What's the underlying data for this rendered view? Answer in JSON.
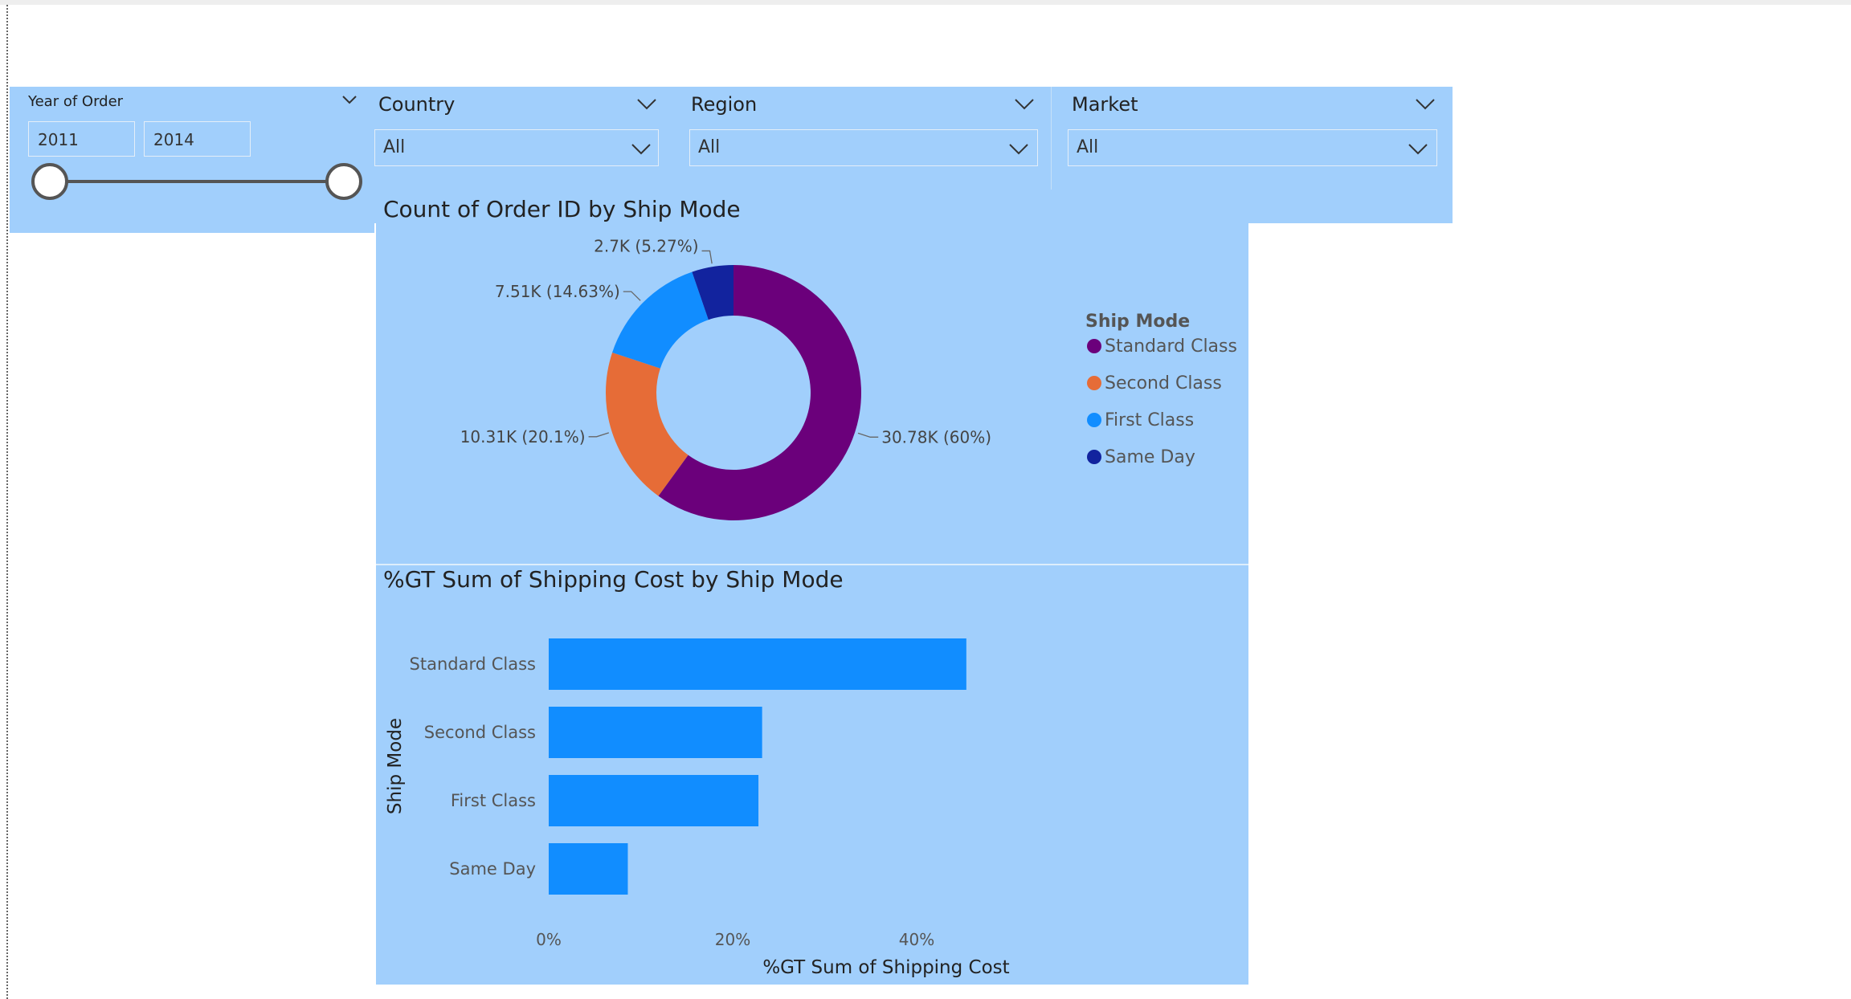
{
  "slicers": {
    "year": {
      "title": "Year of Order",
      "from": "2011",
      "to": "2014"
    },
    "country": {
      "title": "Country",
      "value": "All"
    },
    "region": {
      "title": "Region",
      "value": "All"
    },
    "market": {
      "title": "Market",
      "value": "All"
    }
  },
  "colors": {
    "panel_bg": "#a1cffc",
    "standard_class": "#6b007b",
    "second_class": "#e66c37",
    "first_class": "#118dff",
    "same_day": "#12239e",
    "bar": "#118dff"
  },
  "chart_data": [
    {
      "type": "pie",
      "title": "Count of Order ID by Ship Mode",
      "legend_title": "Ship Mode",
      "legend_placement": "right",
      "categories": [
        "Standard Class",
        "Second Class",
        "First Class",
        "Same Day"
      ],
      "values": [
        30780,
        10310,
        7510,
        2700
      ],
      "data_labels": [
        "30.78K (60%)",
        "10.31K (20.1%)",
        "7.51K (14.63%)",
        "2.7K (5.27%)"
      ]
    },
    {
      "type": "bar",
      "orientation": "horizontal",
      "title": "%GT Sum of Shipping Cost by Ship Mode",
      "xlabel": "%GT Sum of Shipping Cost",
      "ylabel": "Ship Mode",
      "categories": [
        "Standard Class",
        "Second Class",
        "First Class",
        "Same Day"
      ],
      "values": [
        45.4,
        23.2,
        22.8,
        8.6
      ],
      "xlim": [
        0,
        50
      ],
      "xticks": [
        0,
        20,
        40
      ],
      "xtick_labels": [
        "0%",
        "20%",
        "40%"
      ],
      "grid": false
    }
  ]
}
